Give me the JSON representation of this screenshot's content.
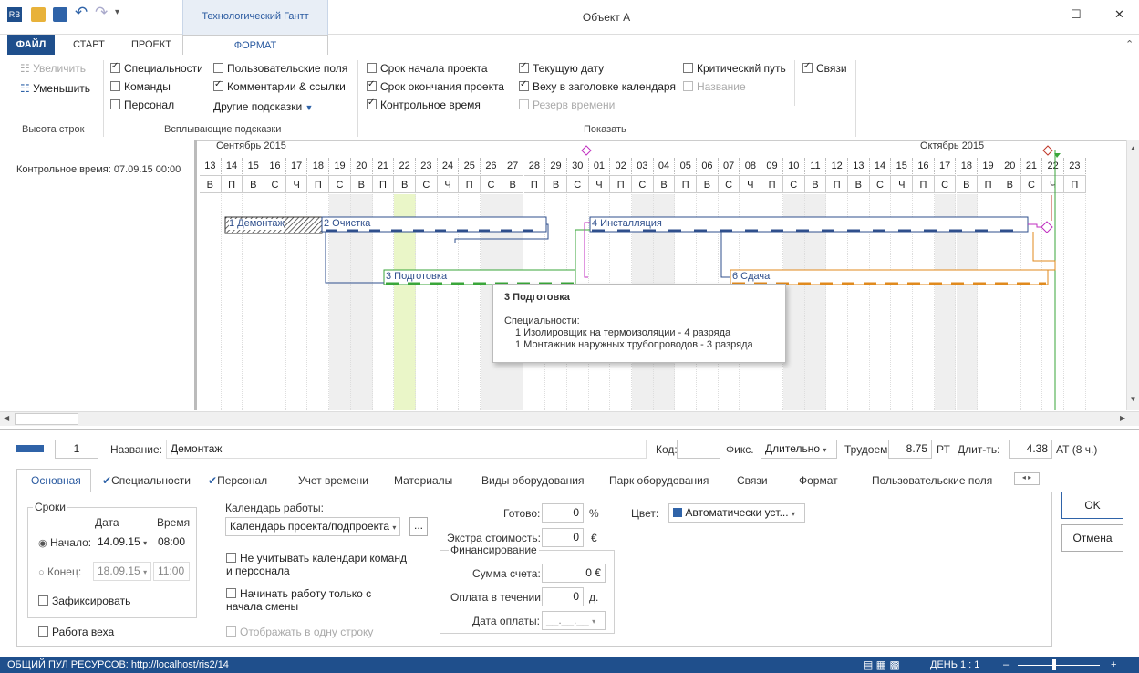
{
  "window": {
    "title": "Объект А",
    "context_tab": "Технологический Гантт",
    "min": "–",
    "max": "☐",
    "close": "✕",
    "collapse": "⌃"
  },
  "tabs": [
    "ФАЙЛ",
    "СТАРТ",
    "ПРОЕКТ",
    "ФОРМАТ"
  ],
  "ribbon": {
    "row_height": {
      "zoom_in": "Увеличить",
      "zoom_out": "Уменьшить",
      "group": "Высота строк"
    },
    "tooltips": {
      "specialties": "Специальности",
      "teams": "Команды",
      "personnel": "Персонал",
      "custom_fields": "Пользовательские поля",
      "comments": "Комментарии & ссылки",
      "other": "Другие подсказки",
      "group": "Всплывающие подсказки"
    },
    "show": {
      "start": "Срок начала проекта",
      "end": "Срок окончания проекта",
      "control": "Контрольное время",
      "current": "Текущую дату",
      "milestone": "Веху в заголовке календаря",
      "reserve": "Резерв времени",
      "critical": "Критический путь",
      "name": "Название",
      "links": "Связи",
      "group": "Показать"
    }
  },
  "gantt": {
    "control_time": "Контрольное время: 07.09.15 00:00",
    "month1": "Сентябрь 2015",
    "month2": "Октябрь 2015",
    "days": [
      "13",
      "14",
      "15",
      "16",
      "17",
      "18",
      "19",
      "20",
      "21",
      "22",
      "23",
      "24",
      "25",
      "26",
      "27",
      "28",
      "29",
      "30",
      "01",
      "02",
      "03",
      "04",
      "05",
      "06",
      "07",
      "08",
      "09",
      "10",
      "11",
      "12",
      "13",
      "14",
      "15",
      "16",
      "17",
      "18",
      "19",
      "20",
      "21",
      "22",
      "23"
    ],
    "weekdays": [
      "В",
      "П",
      "В",
      "С",
      "Ч",
      "П",
      "С",
      "В",
      "П",
      "В",
      "С",
      "Ч",
      "П",
      "С",
      "В",
      "П",
      "В",
      "С",
      "Ч",
      "П",
      "С",
      "В",
      "П",
      "В",
      "С",
      "Ч",
      "П",
      "С",
      "В",
      "П",
      "В",
      "С",
      "Ч",
      "П",
      "С",
      "В",
      "П",
      "В",
      "С",
      "Ч",
      "П"
    ],
    "tasks": {
      "t1": "1 Демонтаж",
      "t2": "2 Очистка",
      "t3": "3 Подготовка",
      "t4": "4 Инсталляция",
      "t6": "6 Сдача"
    },
    "tooltip": {
      "title": "3 Подготовка",
      "heading": "Специальности:",
      "line1": "1 Изолировщик на термоизоляции - 4 разряда",
      "line2": "1 Монтажник наружных трубопроводов - 3 разряда"
    }
  },
  "details": {
    "id": "1",
    "name_label": "Название:",
    "name": "Демонтаж",
    "code_label": "Код:",
    "code": "",
    "fix_label": "Фикс.",
    "fix": "Длительно",
    "work_label": "Трудоем.:",
    "work": "8.75",
    "work_unit": "РТ",
    "dur_label": "Длит-ть:",
    "dur": "4.38",
    "dur_unit": "АТ (8 ч.)",
    "tabs": [
      "Основная",
      "Специальности",
      "Персонал",
      "Учет времени",
      "Материалы",
      "Виды оборудования",
      "Парк оборудования",
      "Связи",
      "Формат",
      "Пользовательские поля"
    ],
    "dates": {
      "group": "Сроки",
      "date": "Дата",
      "time": "Время",
      "start_label": "Начало:",
      "start_date": "14.09.15",
      "start_time": "08:00",
      "end_label": "Конец:",
      "end_date": "18.09.15",
      "end_time": "11:00",
      "fix": "Зафиксировать",
      "milestone": "Работа веха"
    },
    "calendar": {
      "label": "Календарь работы:",
      "value": "Календарь проекта/подпроекта",
      "ignore": "Не учитывать календари команд и персонала",
      "start_shift": "Начинать работу только с начала смены",
      "one_line": "Отображать в одну строку",
      "more": "..."
    },
    "cost": {
      "done_label": "Готово:",
      "done": "0",
      "done_unit": "%",
      "extra_label": "Экстра стоимость:",
      "extra": "0",
      "extra_unit": "€",
      "fin_group": "Финансирование",
      "invoice_label": "Сумма счета:",
      "invoice": "0",
      "invoice_unit": "€",
      "pay_label": "Оплата в течении:",
      "pay": "0",
      "pay_unit": "д.",
      "paydate_label": "Дата оплаты:",
      "paydate": "__.__.__"
    },
    "color_label": "Цвет:",
    "color": "Автоматически уст...",
    "ok": "OK",
    "cancel": "Отмена"
  },
  "status": {
    "pool": "ОБЩИЙ ПУЛ РЕСУРСОВ: http://localhost/ris2/14",
    "zoom": "ДЕНЬ 1 : 1"
  }
}
